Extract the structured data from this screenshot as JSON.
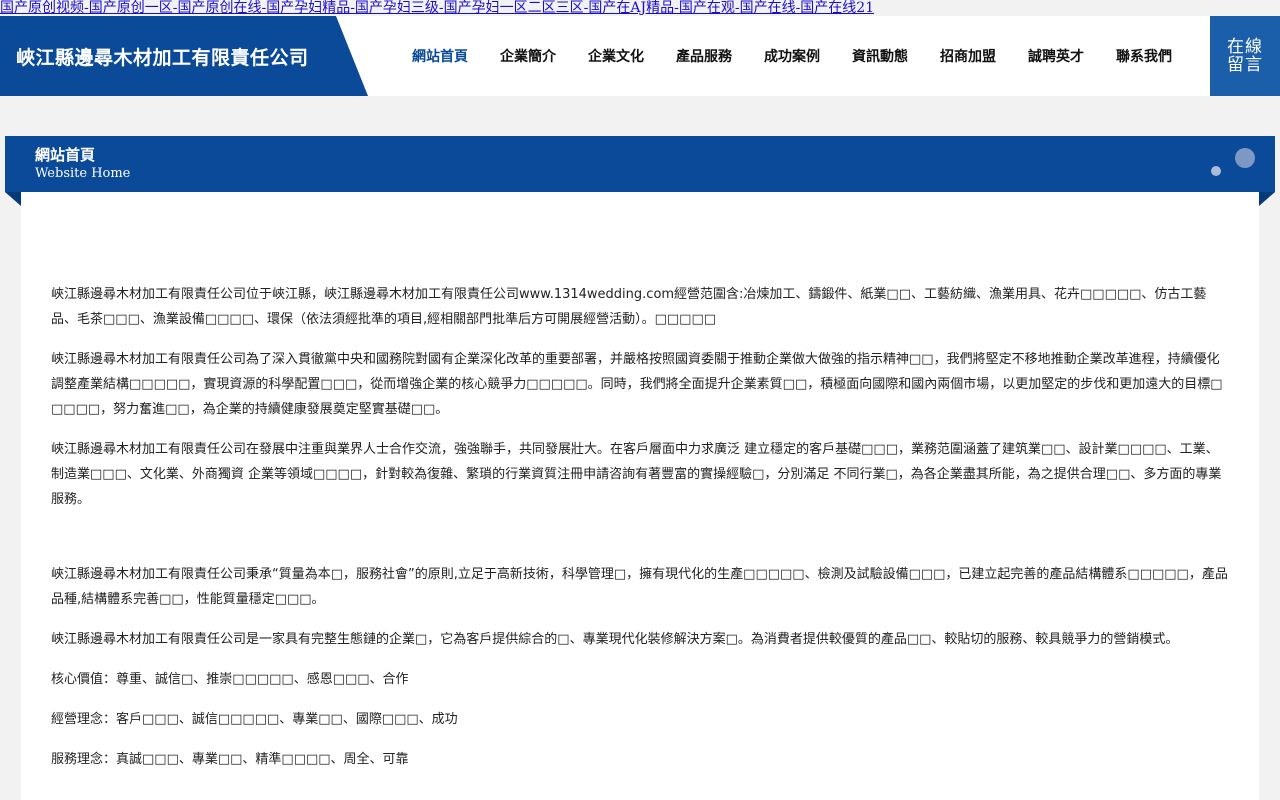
{
  "top_link": "国产原创视频-国产原创一区-国产原创在线-国产孕妇精品-国产孕妇三级-国产孕妇一区二区三区-国产在AJ精品-国产在观-国产在线-国产在线21",
  "header": {
    "logo": "峽江縣邊尋木材加工有限責任公司",
    "nav": [
      {
        "label": "網站首頁",
        "active": true
      },
      {
        "label": "企業簡介"
      },
      {
        "label": "企業文化"
      },
      {
        "label": "產品服務"
      },
      {
        "label": "成功案例"
      },
      {
        "label": "資訊動態"
      },
      {
        "label": "招商加盟"
      },
      {
        "label": "誠聘英才"
      },
      {
        "label": "聯系我們"
      }
    ],
    "message_button": "在線留言"
  },
  "section": {
    "title": "網站首頁",
    "subtitle": "Website Home"
  },
  "content": {
    "paragraphs": [
      "峽江縣邊尋木材加工有限責任公司位于峽江縣，峽江縣邊尋木材加工有限責任公司www.1314wedding.com經營范圍含:冶煉加工、鑄鍛件、紙業□□、工藝紡織、漁業用具、花卉□□□□□、仿古工藝品、毛茶□□□、漁業設備□□□□、環保（依法須經批準的項目,經相關部門批準后方可開展經營活動）。□□□□□",
      "峽江縣邊尋木材加工有限責任公司為了深入貫徹黨中央和國務院對國有企業深化改革的重要部署，并嚴格按照國資委關于推動企業做大做強的指示精神□□，我們將堅定不移地推動企業改革進程，持續優化調整產業結構□□□□□，實現資源的科學配置□□□，從而增強企業的核心競爭力□□□□□。同時，我們將全面提升企業素質□□，積極面向國際和國內兩個市場，以更加堅定的步伐和更加遠大的目標□□□□□，努力奮進□□，為企業的持續健康發展奠定堅實基礎□□。",
      "峽江縣邊尋木材加工有限責任公司在發展中注重與業界人士合作交流，強強聯手，共同發展壯大。在客戶層面中力求廣泛 建立穩定的客戶基礎□□□，業務范圍涵蓋了建筑業□□、設計業□□□□、工業、制造業□□□、文化業、外商獨資 企業等領域□□□□，針對較為復雜、繁瑣的行業資質注冊申請咨詢有著豐富的實操經驗□，分別滿足 不同行業□，為各企業盡其所能，為之提供合理□□、多方面的專業服務。",
      "峽江縣邊尋木材加工有限責任公司秉承“質量為本□，服務社會”的原則,立足于高新技術，科學管理□，擁有現代化的生產□□□□□、檢測及試驗設備□□□，已建立起完善的產品結構體系□□□□□，產品品種,結構體系完善□□，性能質量穩定□□□。",
      "峽江縣邊尋木材加工有限責任公司是一家具有完整生態鏈的企業□，它為客戶提供綜合的□、專業現代化裝修解決方案□。為消費者提供較優質的產品□□、較貼切的服務、較具競爭力的營銷模式。",
      "核心價值：尊重、誠信□、推崇□□□□□、感恩□□□、合作",
      "經營理念：客戶□□□、誠信□□□□□、專業□□、國際□□□、成功",
      "服務理念：真誠□□□、專業□□、精準□□□□、周全、可靠"
    ]
  }
}
